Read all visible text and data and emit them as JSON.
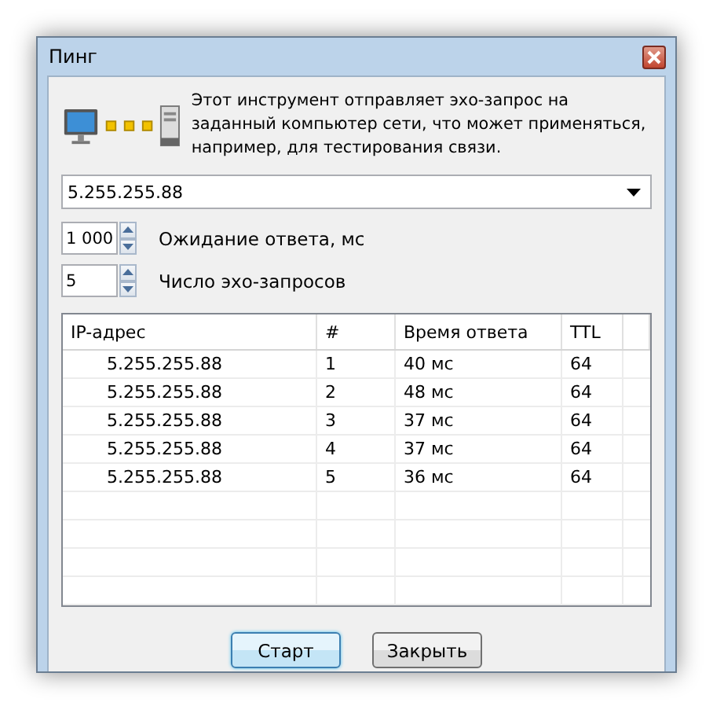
{
  "window": {
    "title": "Пинг"
  },
  "description": "Этот инструмент отправляет эхо-запрос на заданный компьютер сети, что может применяться, например, для тестирования связи.",
  "address": {
    "value": "5.255.255.88"
  },
  "spinners": [
    {
      "value": "1 000",
      "label": "Ожидание ответа, мс"
    },
    {
      "value": "5",
      "label": "Число эхо-запросов"
    }
  ],
  "table": {
    "columns": [
      "IP-адрес",
      "#",
      "Время ответа",
      "TTL"
    ],
    "rows": [
      [
        "5.255.255.88",
        "1",
        "40 мс",
        "64"
      ],
      [
        "5.255.255.88",
        "2",
        "48 мс",
        "64"
      ],
      [
        "5.255.255.88",
        "3",
        "37 мс",
        "64"
      ],
      [
        "5.255.255.88",
        "4",
        "37 мс",
        "64"
      ],
      [
        "5.255.255.88",
        "5",
        "36 мс",
        "64"
      ]
    ]
  },
  "buttons": [
    {
      "label": "Старт",
      "default": true
    },
    {
      "label": "Закрыть",
      "default": false
    }
  ]
}
